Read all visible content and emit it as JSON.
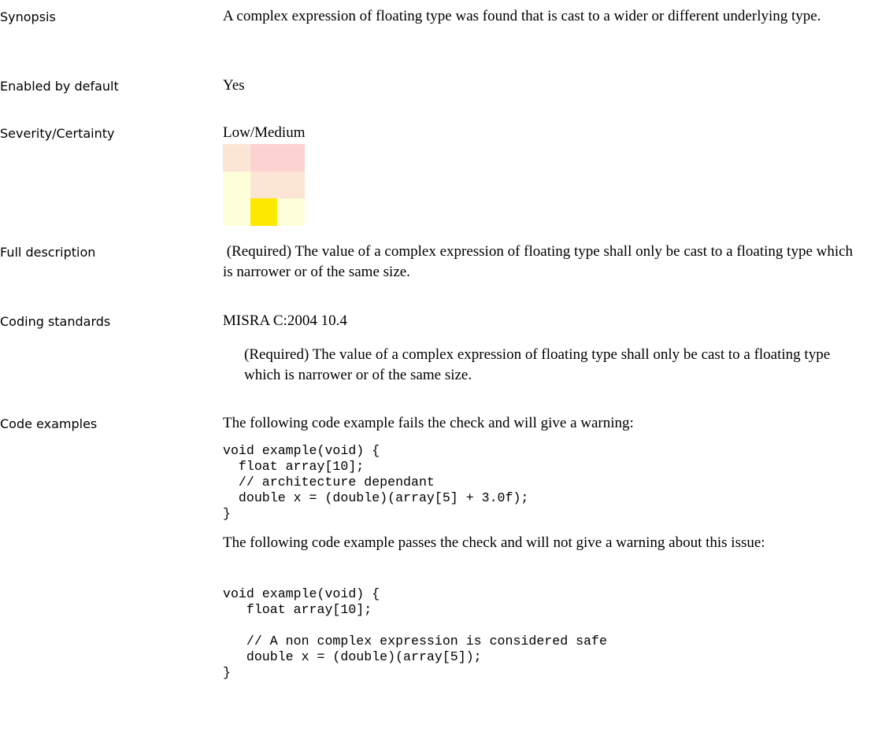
{
  "fields": {
    "synopsis": {
      "label": "Synopsis",
      "text": "A complex expression of floating type was found that is cast to a wider or different underlying type."
    },
    "enabled": {
      "label": "Enabled by default",
      "text": "Yes"
    },
    "severity": {
      "label": "Severity/Certainty",
      "text": "Low/Medium"
    },
    "full_description": {
      "label": "Full description",
      "text": " (Required) The value of a complex expression of floating type shall only be cast to a floating type which is narrower or of the same size."
    },
    "coding_standards": {
      "label": "Coding standards",
      "standard": "MISRA C:2004 10.4",
      "detail": "(Required) The value of a complex expression of floating type shall only be cast to a floating type which is narrower or of the same size."
    },
    "code_examples": {
      "label": "Code examples",
      "fail_intro": "The following code example fails the check and will give a warning:",
      "fail_code": "void example(void) {\n  float array[10];\n  // architecture dependant\n  double x = (double)(array[5] + 3.0f);\n}",
      "pass_intro": "The following code example passes the check and will not give a warning about this issue:",
      "pass_code": "void example(void) {\n   float array[10];\n\n   // A non complex expression is considered safe\n   double x = (double)(array[5]);\n}"
    }
  },
  "severity_matrix": {
    "selected": "Low/Medium",
    "cells": [
      [
        "#fde5d6",
        "#fdd2d3",
        "#fdd2d3"
      ],
      [
        "#fefedb",
        "#fde5d6",
        "#fde5d6"
      ],
      [
        "#fefedb",
        "#fde800",
        "#fefedb"
      ]
    ]
  }
}
